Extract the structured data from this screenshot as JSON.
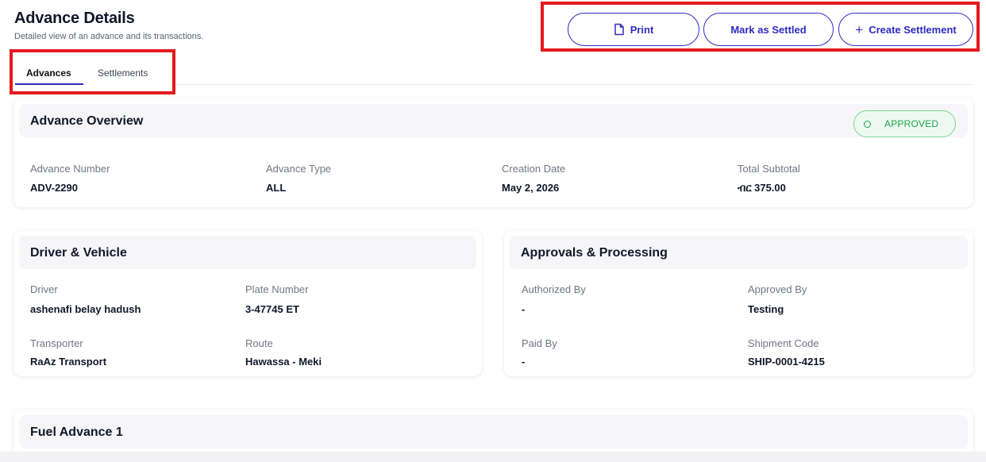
{
  "header": {
    "title": "Advance Details",
    "subtitle": "Detailed view of an advance and its transactions."
  },
  "actions": {
    "print": "Print",
    "mark_settled": "Mark as Settled",
    "create_plus": "+",
    "create_settlement": "Create Settlement"
  },
  "tabs": [
    {
      "label": "Advances",
      "active": true
    },
    {
      "label": "Settlements",
      "active": false
    }
  ],
  "overview": {
    "title": "Advance Overview",
    "status": "APPROVED",
    "status_color": "#1aa34a",
    "fields": [
      {
        "label": "Advance Number",
        "value": "ADV-2290"
      },
      {
        "label": "Advance Type",
        "value": "ALL"
      },
      {
        "label": "Creation Date",
        "value": "May 2, 2026"
      },
      {
        "label": "Total Subtotal",
        "value": "ብር 375.00"
      }
    ]
  },
  "driver_vehicle": {
    "title": "Driver & Vehicle",
    "fields": [
      {
        "label": "Driver",
        "value": "ashenafi belay hadush"
      },
      {
        "label": "Plate Number",
        "value": "3-47745 ET"
      },
      {
        "label": "Transporter",
        "value": "RaAz Transport"
      },
      {
        "label": "Route",
        "value": "Hawassa - Meki"
      }
    ]
  },
  "approvals": {
    "title": "Approvals & Processing",
    "fields": [
      {
        "label": "Authorized By",
        "value": "-"
      },
      {
        "label": "Approved By",
        "value": "Testing"
      },
      {
        "label": "Paid By",
        "value": "-"
      },
      {
        "label": "Shipment Code",
        "value": "SHIP-0001-4215"
      }
    ]
  },
  "fuel": {
    "title": "Fuel Advance 1"
  },
  "colors": {
    "accent": "#2f2bc2",
    "highlight_box": "#e3191f",
    "success": "#1aa34a"
  }
}
